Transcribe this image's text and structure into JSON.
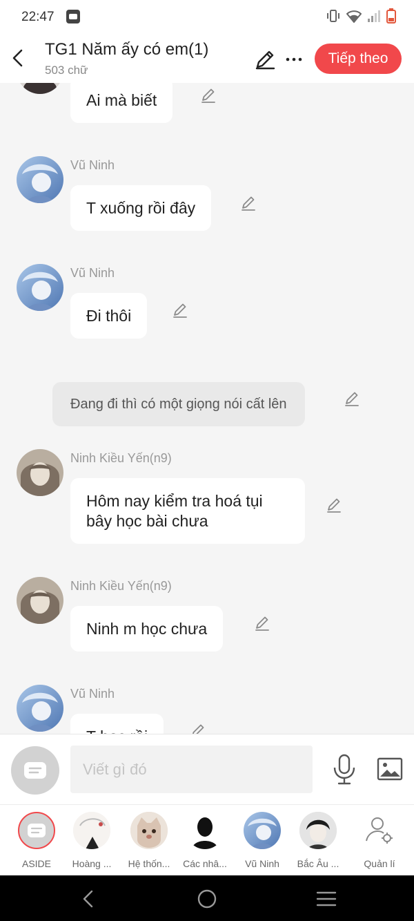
{
  "status": {
    "time": "22:47"
  },
  "header": {
    "title": "TG1 Năm ấy có em(1)",
    "word_count": "503 chữ",
    "next_label": "Tiếp theo"
  },
  "messages": [
    {
      "kind": "chat",
      "sender": "",
      "text": "Ai mà biết",
      "avatar": "girl-white-hair"
    },
    {
      "kind": "chat",
      "sender": "Vũ Ninh",
      "text": "T xuống rồi đây",
      "avatar": "blue-anime-boy"
    },
    {
      "kind": "chat",
      "sender": "Vũ Ninh",
      "text": "Đi thôi",
      "avatar": "blue-anime-boy"
    },
    {
      "kind": "narration",
      "text": "Đang đi thì có một giọng nói cất lên"
    },
    {
      "kind": "chat",
      "sender": "Ninh Kiều Yến(n9)",
      "text": "Hôm nay kiểm tra hoá tụi bây học bài chưa",
      "avatar": "sepia-girl"
    },
    {
      "kind": "chat",
      "sender": "Ninh Kiều Yến(n9)",
      "text": "Ninh m học chưa",
      "avatar": "sepia-girl"
    },
    {
      "kind": "chat",
      "sender": "Vũ Ninh",
      "text": "T học rồi",
      "avatar": "blue-anime-boy"
    }
  ],
  "input": {
    "placeholder": "Viết gì đó"
  },
  "characters": [
    {
      "label": "ASIDE",
      "icon": "aside-chat-icon"
    },
    {
      "label": "Hoàng ...",
      "icon": "white-sketch-avatar"
    },
    {
      "label": "Hệ thốn...",
      "icon": "cat-avatar"
    },
    {
      "label": "Các nhâ...",
      "icon": "silhouette-avatar"
    },
    {
      "label": "Vũ Ninh",
      "icon": "blue-anime-boy"
    },
    {
      "label": "Bắc Âu ...",
      "icon": "dark-hair-boy"
    },
    {
      "label": "Quản lí",
      "icon": "user-settings-icon"
    }
  ],
  "colors": {
    "accent": "#f1484b",
    "background": "#f5f5f5",
    "bubble": "#ffffff",
    "narration": "#e9e9e9"
  }
}
